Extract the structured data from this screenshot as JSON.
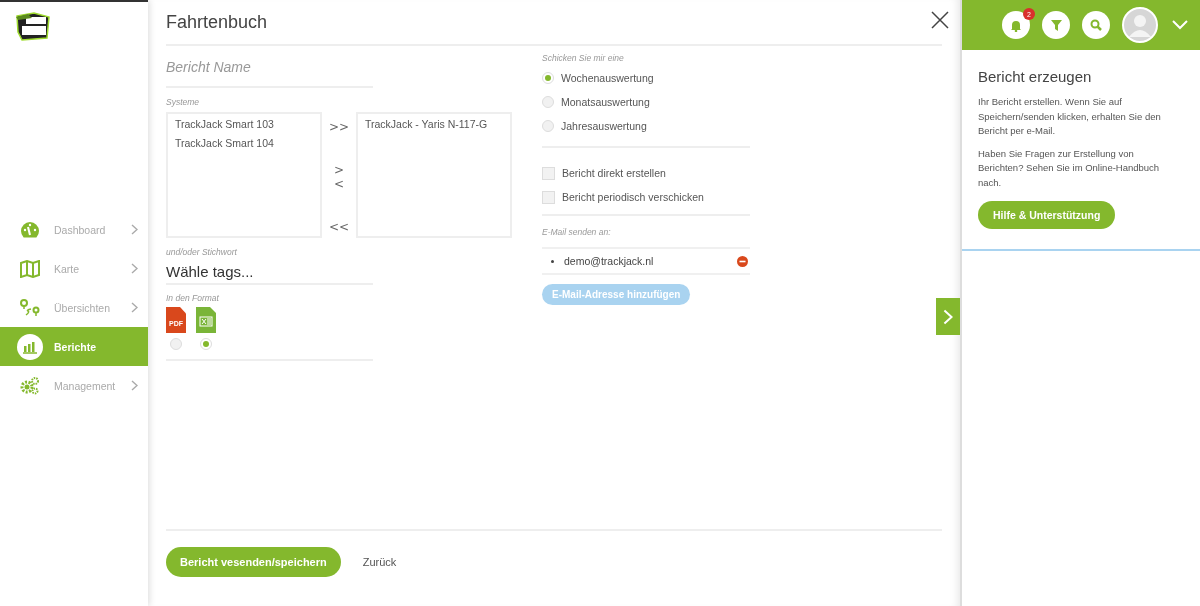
{
  "sidebar": {
    "items": [
      {
        "label": "Dashboard",
        "kind": "gauge",
        "selected": false
      },
      {
        "label": "Karte",
        "kind": "map",
        "selected": false
      },
      {
        "label": "Übersichten",
        "kind": "route",
        "selected": false
      },
      {
        "label": "Berichte",
        "kind": "chart",
        "selected": true
      },
      {
        "label": "Management",
        "kind": "gears",
        "selected": false
      }
    ]
  },
  "dialog": {
    "title": "Fahrtenbuch",
    "name_field": {
      "placeholder": "Bericht Name"
    },
    "systems": {
      "label": "Systeme",
      "available": [
        "TrackJack Smart 103",
        "TrackJack Smart 104"
      ],
      "chosen": [
        "TrackJack - Yaris N-117-G"
      ],
      "move_buttons": [
        ">>",
        ">",
        "<",
        "<<"
      ]
    },
    "tags": {
      "label": "und/oder Stichwort",
      "placeholder": "Wähle tags..."
    },
    "format": {
      "label": "In den Format",
      "options": [
        {
          "kind": "pdf",
          "label": "PDF",
          "selected": false
        },
        {
          "kind": "excel",
          "selected": true
        }
      ]
    },
    "frequency": {
      "label": "Schicken Sie mir eine",
      "options": [
        {
          "label": "Wochenauswertung",
          "selected": true
        },
        {
          "label": "Monatsauswertung",
          "selected": false
        },
        {
          "label": "Jahresauswertung",
          "selected": false
        }
      ]
    },
    "options": [
      {
        "label": "Bericht direkt erstellen",
        "checked": false
      },
      {
        "label": "Bericht periodisch verschicken",
        "checked": false
      }
    ],
    "email": {
      "label": "E-Mail senden an:",
      "recipients": [
        "demo@trackjack.nl"
      ],
      "add_button": {
        "label": "E-Mail-Adresse hinzufügen",
        "disabled": true
      }
    },
    "footer": {
      "primary": "Bericht vesenden/speichern",
      "secondary": "Zurück"
    }
  },
  "header": {
    "notification_count": "2"
  },
  "help_panel": {
    "title": "Bericht erzeugen",
    "paragraphs": [
      "Ihr Bericht erstellen. Wenn Sie auf Speichern/senden klicken, erhalten Sie den Bericht per e-Mail.",
      "Haben Sie Fragen zur Erstellung von Berichten? Sehen Sie im Online-Handbuch nach."
    ],
    "button": "Hilfe & Unterstützung"
  }
}
